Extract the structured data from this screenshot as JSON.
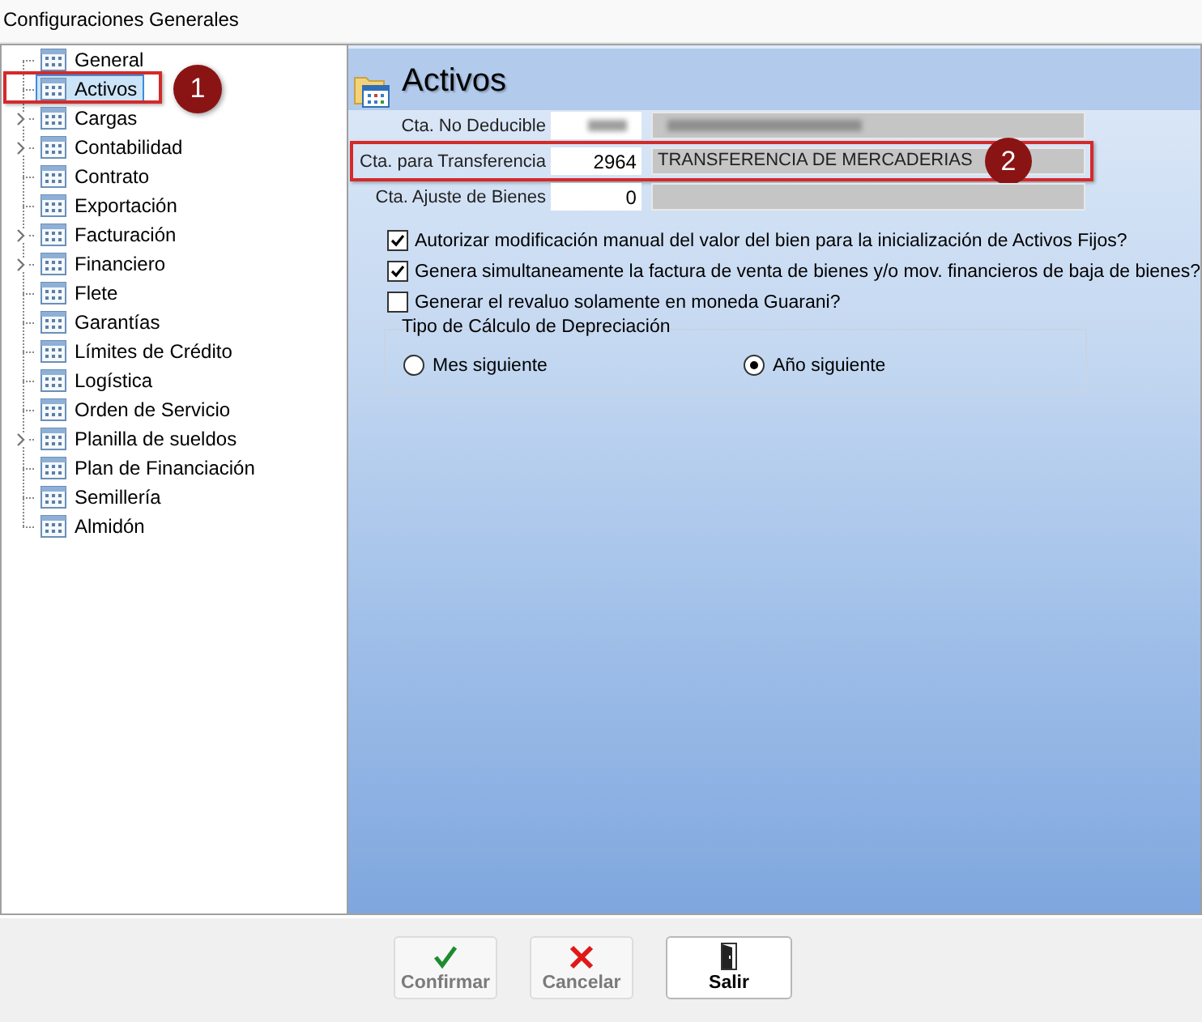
{
  "window": {
    "title": "Configuraciones Generales"
  },
  "tree": {
    "items": [
      {
        "label": "General",
        "expandable": false,
        "selected": false
      },
      {
        "label": "Activos",
        "expandable": false,
        "selected": true,
        "callout": "1"
      },
      {
        "label": "Cargas",
        "expandable": true,
        "selected": false
      },
      {
        "label": "Contabilidad",
        "expandable": true,
        "selected": false
      },
      {
        "label": "Contrato",
        "expandable": false,
        "selected": false
      },
      {
        "label": "Exportación",
        "expandable": false,
        "selected": false
      },
      {
        "label": "Facturación",
        "expandable": true,
        "selected": false
      },
      {
        "label": "Financiero",
        "expandable": true,
        "selected": false
      },
      {
        "label": "Flete",
        "expandable": false,
        "selected": false
      },
      {
        "label": "Garantías",
        "expandable": false,
        "selected": false
      },
      {
        "label": "Límites de Crédito",
        "expandable": false,
        "selected": false
      },
      {
        "label": "Logística",
        "expandable": false,
        "selected": false
      },
      {
        "label": "Orden de Servicio",
        "expandable": false,
        "selected": false
      },
      {
        "label": "Planilla de sueldos",
        "expandable": true,
        "selected": false
      },
      {
        "label": "Plan de Financiación",
        "expandable": false,
        "selected": false
      },
      {
        "label": "Semillería",
        "expandable": false,
        "selected": false
      },
      {
        "label": "Almidón",
        "expandable": false,
        "selected": false
      }
    ]
  },
  "panel": {
    "title": "Activos",
    "fields": [
      {
        "label": "Cta. No Deducible",
        "redacted": true
      },
      {
        "label": "Cta. para Transferencia",
        "redacted": false,
        "code": "2964",
        "description": "TRANSFERENCIA DE MERCADERIAS",
        "callout": "2"
      },
      {
        "label": "Cta. Ajuste de Bienes",
        "redacted": false,
        "code": "0"
      }
    ],
    "checkboxes": [
      {
        "label": "Autorizar modificación manual del valor del bien para la inicialización de Activos Fijos?",
        "checked": true
      },
      {
        "label": "Genera simultaneamente la factura de venta de bienes y/o mov. financieros de baja de bienes?",
        "checked": true
      },
      {
        "label": "Generar el revaluo solamente en moneda Guarani?",
        "checked": false
      }
    ],
    "depreciation": {
      "title": "Tipo de Cálculo de Depreciación",
      "options": [
        {
          "label": "Mes siguiente",
          "selected": false
        },
        {
          "label": "Año siguiente",
          "selected": true
        }
      ]
    }
  },
  "buttons": [
    {
      "label": "Confirmar",
      "kind": "confirm",
      "disabled": true
    },
    {
      "label": "Cancelar",
      "kind": "cancel",
      "disabled": true
    },
    {
      "label": "Salir",
      "kind": "exit",
      "disabled": false
    }
  ]
}
